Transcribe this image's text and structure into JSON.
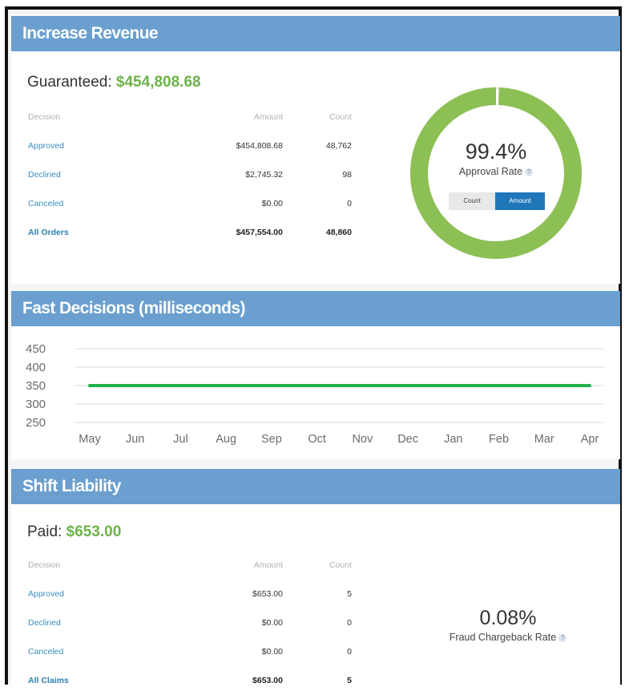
{
  "revenue": {
    "header": "Increase Revenue",
    "guaranteed_label": "Guaranteed:",
    "guaranteed_value": "$454,808.68",
    "columns": [
      "Decision",
      "Amount",
      "Count"
    ],
    "rows": [
      {
        "decision": "Approved",
        "amount": "$454,808.68",
        "count": "48,762"
      },
      {
        "decision": "Declined",
        "amount": "$2,745.32",
        "count": "98"
      },
      {
        "decision": "Canceled",
        "amount": "$0.00",
        "count": "0"
      },
      {
        "decision": "All Orders",
        "amount": "$457,554.00",
        "count": "48,860"
      }
    ],
    "approval_pct": "99.4%",
    "approval_label": "Approval Rate",
    "approval_fraction": 0.994,
    "toggle_count": "Count",
    "toggle_amount": "Amount",
    "help_icon": "question-mark-icon"
  },
  "decisions": {
    "header": "Fast Decisions (milliseconds)",
    "chart_data": {
      "type": "line",
      "x": [
        "May",
        "Jun",
        "Jul",
        "Aug",
        "Sep",
        "Oct",
        "Nov",
        "Dec",
        "Jan",
        "Feb",
        "Mar",
        "Apr"
      ],
      "y_ticks": [
        "450",
        "400",
        "350",
        "300",
        "250"
      ],
      "ylim": [
        250,
        450
      ],
      "series": [
        {
          "values": [
            350,
            350,
            350,
            350,
            350,
            350,
            350,
            350,
            350,
            350,
            350,
            350
          ],
          "color": "#22b04b"
        }
      ],
      "grid": true
    }
  },
  "liability": {
    "header": "Shift Liability",
    "paid_label": "Paid:",
    "paid_value": "$653.00",
    "columns": [
      "Decision",
      "Amount",
      "Count"
    ],
    "rows": [
      {
        "decision": "Approved",
        "amount": "$653.00",
        "count": "5"
      },
      {
        "decision": "Declined",
        "amount": "$0.00",
        "count": "0"
      },
      {
        "decision": "Canceled",
        "amount": "$0.00",
        "count": "0"
      },
      {
        "decision": "All Claims",
        "amount": "$653.00",
        "count": "5"
      }
    ],
    "fraud_pct": "0.08%",
    "fraud_label": "Fraud Chargeback Rate"
  },
  "colors": {
    "header_blue": "#6a9fcf",
    "value_green": "#6db24a",
    "donut_green": "#8cbf54",
    "link_blue": "#3a8fc0"
  }
}
